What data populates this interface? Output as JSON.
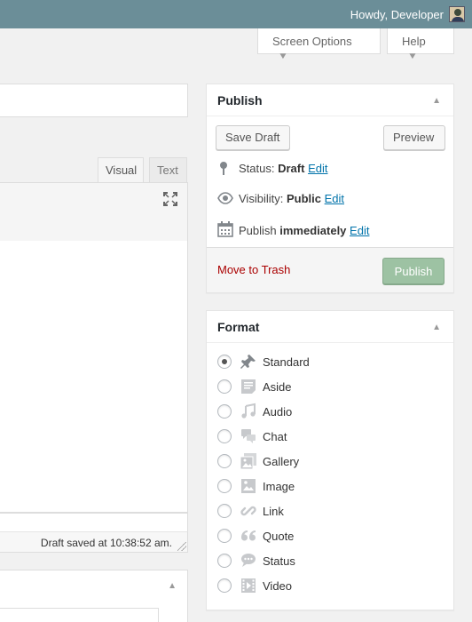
{
  "adminbar": {
    "greeting": "Howdy, Developer"
  },
  "screen_meta": {
    "screen_options": "Screen Options",
    "help": "Help"
  },
  "editor": {
    "tabs": [
      {
        "label": "Visual"
      },
      {
        "label": "Text"
      }
    ],
    "status": "Draft saved at 10:38:52 am."
  },
  "publish": {
    "title": "Publish",
    "save_draft": "Save Draft",
    "preview": "Preview",
    "status_label": "Status:",
    "status_value": "Draft",
    "visibility_label": "Visibility:",
    "visibility_value": "Public",
    "schedule_label": "Publish",
    "schedule_value": "immediately",
    "edit": "Edit",
    "trash": "Move to Trash",
    "publish_button": "Publish"
  },
  "format": {
    "title": "Format",
    "options": [
      {
        "label": "Standard",
        "icon": "pin-icon",
        "checked": true
      },
      {
        "label": "Aside",
        "icon": "aside-icon",
        "checked": false
      },
      {
        "label": "Audio",
        "icon": "audio-icon",
        "checked": false
      },
      {
        "label": "Chat",
        "icon": "chat-icon",
        "checked": false
      },
      {
        "label": "Gallery",
        "icon": "gallery-icon",
        "checked": false
      },
      {
        "label": "Image",
        "icon": "image-icon",
        "checked": false
      },
      {
        "label": "Link",
        "icon": "link-icon",
        "checked": false
      },
      {
        "label": "Quote",
        "icon": "quote-icon",
        "checked": false
      },
      {
        "label": "Status",
        "icon": "status-icon",
        "checked": false
      },
      {
        "label": "Video",
        "icon": "video-icon",
        "checked": false
      }
    ]
  },
  "colors": {
    "adminbar": "#6b8e98",
    "link": "#0073aa",
    "trash": "#aa0000",
    "publish_button": "#9dc2a3"
  }
}
